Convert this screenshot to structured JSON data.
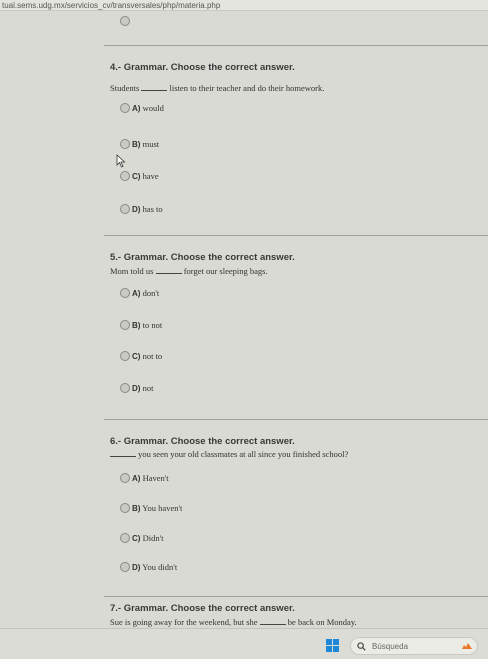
{
  "browser": {
    "url": "tual.sems.udg.mx/servicios_cv/transversales/php/materia.php"
  },
  "questions": [
    {
      "title": "4.- Grammar. Choose the correct answer.",
      "prompt_before": "Students",
      "prompt_after": "listen to their teacher and do their homework.",
      "options": [
        {
          "key": "A)",
          "text": "would"
        },
        {
          "key": "B)",
          "text": "must"
        },
        {
          "key": "C)",
          "text": "have"
        },
        {
          "key": "D)",
          "text": "has to"
        }
      ]
    },
    {
      "title": "5.- Grammar. Choose the correct answer.",
      "prompt_before": "Mom told us",
      "prompt_after": "forget our sleeping bags.",
      "options": [
        {
          "key": "A)",
          "text": "don't"
        },
        {
          "key": "B)",
          "text": "to not"
        },
        {
          "key": "C)",
          "text": "not to"
        },
        {
          "key": "D)",
          "text": "not"
        }
      ]
    },
    {
      "title": "6.- Grammar. Choose the correct answer.",
      "prompt_before": "",
      "prompt_after": "you seen your old classmates at all since you finished school?",
      "options": [
        {
          "key": "A)",
          "text": "Haven't"
        },
        {
          "key": "B)",
          "text": "You haven't"
        },
        {
          "key": "C)",
          "text": "Didn't"
        },
        {
          "key": "D)",
          "text": "You didn't"
        }
      ]
    },
    {
      "title": "7.- Grammar. Choose the correct answer.",
      "prompt_before": "Sue is going away for the weekend, but she",
      "prompt_after": "be back on Monday."
    }
  ],
  "taskbar": {
    "search_placeholder": "Búsqueda"
  },
  "icons": {
    "windows": "windows-logo-icon",
    "search": "search-icon",
    "weather": "weather-icon"
  }
}
